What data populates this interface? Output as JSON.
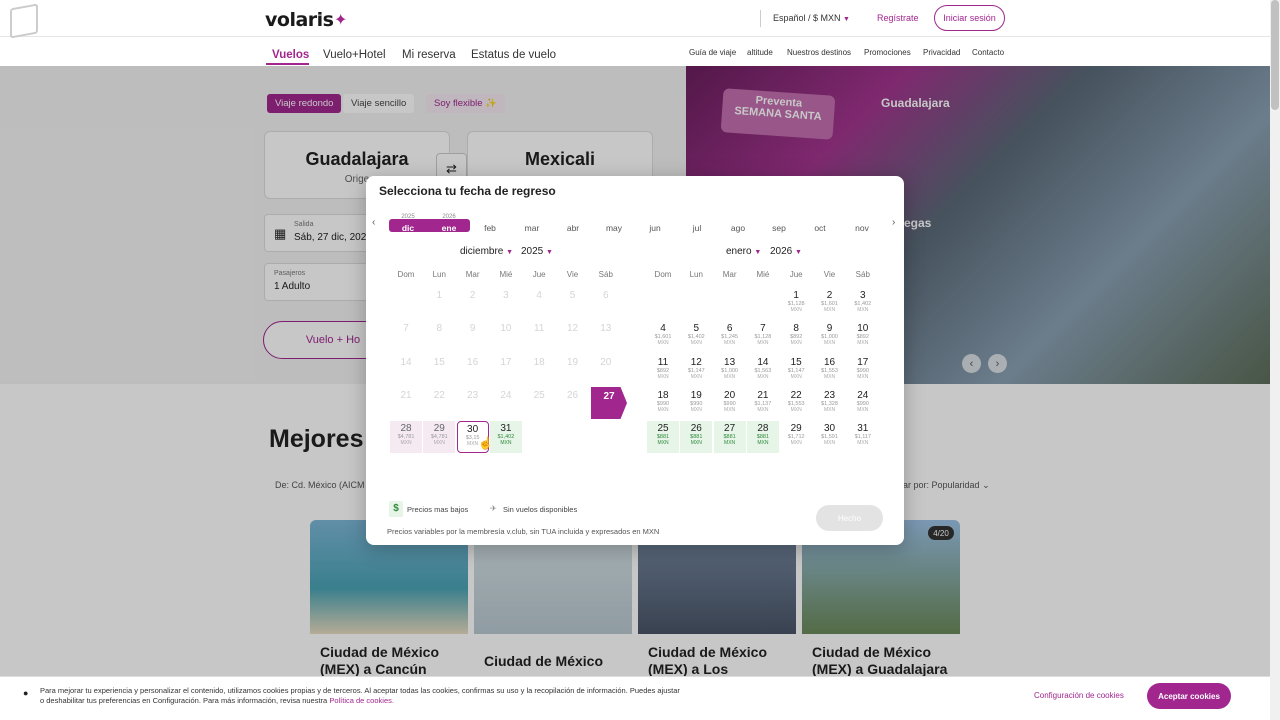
{
  "header": {
    "logo": "volaris",
    "language": "Español / $ MXN",
    "register": "Regístrate",
    "login": "Iniciar sesión"
  },
  "nav": {
    "tabs": [
      "Vuelos",
      "Vuelo+Hotel",
      "Mi reserva",
      "Estatus de vuelo"
    ],
    "links": [
      "Guía de viaje",
      "altitude",
      "Nuestros destinos",
      "Promociones",
      "Privacidad",
      "Contacto"
    ]
  },
  "hero": {
    "badge_line1": "Preventa",
    "badge_line2": "SEMANA SANTA",
    "city1": "Guadalajara",
    "city2": "egas"
  },
  "search": {
    "trip_round": "Viaje redondo",
    "trip_one": "Viaje sencillo",
    "trip_flex": "Soy flexible ✨",
    "origin": "Guadalajara",
    "origin_sub": "Orige",
    "destination": "Mexicali",
    "depart_label": "Salida",
    "depart_value": "Sáb, 27 dic, 2025",
    "pax_label": "Pasajeros",
    "pax_value": "1 Adulto",
    "search_button": "Vuelo + Ho"
  },
  "lower": {
    "title": "Mejores v",
    "filter_origin": "De: Cd. México (AICM",
    "sort": "ar por: Popularidad",
    "pager": "4/20",
    "cards": [
      "Ciudad de México (MEX) a Cancún",
      "Ciudad de México",
      "Ciudad de México (MEX) a Los Ángeles",
      "Ciudad de México (MEX) a Guadalajara"
    ]
  },
  "modal": {
    "title": "Selecciona tu fecha de regreso",
    "strip": [
      {
        "year": "2025",
        "label": "dic",
        "selected": true
      },
      {
        "year": "2026",
        "label": "ene",
        "selected": true
      },
      {
        "year": "",
        "label": "feb"
      },
      {
        "year": "",
        "label": "mar"
      },
      {
        "year": "",
        "label": "abr"
      },
      {
        "year": "",
        "label": "may"
      },
      {
        "year": "",
        "label": "jun"
      },
      {
        "year": "",
        "label": "jul"
      },
      {
        "year": "",
        "label": "ago"
      },
      {
        "year": "",
        "label": "sep"
      },
      {
        "year": "",
        "label": "oct"
      },
      {
        "year": "",
        "label": "nov"
      }
    ],
    "weekdays": [
      "Dom",
      "Lun",
      "Mar",
      "Mié",
      "Jue",
      "Vie",
      "Sáb"
    ],
    "left_month": "diciembre",
    "left_year": "2025",
    "right_month": "enero",
    "right_year": "2026",
    "currency": "MXN",
    "left_days": [
      {
        "d": "1",
        "p": ""
      },
      {
        "d": "2",
        "p": ""
      },
      {
        "d": "3",
        "p": ""
      },
      {
        "d": "4",
        "p": ""
      },
      {
        "d": "5",
        "p": ""
      },
      {
        "d": "6",
        "p": ""
      },
      {
        "d": "7",
        "p": ""
      },
      {
        "d": "8",
        "p": ""
      },
      {
        "d": "9",
        "p": ""
      },
      {
        "d": "10",
        "p": ""
      },
      {
        "d": "11",
        "p": ""
      },
      {
        "d": "12",
        "p": ""
      },
      {
        "d": "13",
        "p": ""
      },
      {
        "d": "14",
        "p": ""
      },
      {
        "d": "15",
        "p": ""
      },
      {
        "d": "16",
        "p": ""
      },
      {
        "d": "17",
        "p": ""
      },
      {
        "d": "18",
        "p": ""
      },
      {
        "d": "19",
        "p": ""
      },
      {
        "d": "20",
        "p": ""
      },
      {
        "d": "21",
        "p": ""
      },
      {
        "d": "22",
        "p": ""
      },
      {
        "d": "23",
        "p": ""
      },
      {
        "d": "24",
        "p": ""
      },
      {
        "d": "25",
        "p": ""
      },
      {
        "d": "26",
        "p": ""
      },
      {
        "d": "27",
        "p": ""
      },
      {
        "d": "28",
        "p": "$4,781"
      },
      {
        "d": "29",
        "p": "$4,781"
      },
      {
        "d": "30",
        "p": "$3,15"
      },
      {
        "d": "31",
        "p": "$1,402"
      }
    ],
    "right_days": [
      {
        "d": "1",
        "p": "$1,128"
      },
      {
        "d": "2",
        "p": "$1,601"
      },
      {
        "d": "3",
        "p": "$1,402"
      },
      {
        "d": "4",
        "p": "$1,601"
      },
      {
        "d": "5",
        "p": "$1,402"
      },
      {
        "d": "6",
        "p": "$1,245"
      },
      {
        "d": "7",
        "p": "$1,128"
      },
      {
        "d": "8",
        "p": "$892"
      },
      {
        "d": "9",
        "p": "$1,000"
      },
      {
        "d": "10",
        "p": "$892"
      },
      {
        "d": "11",
        "p": "$892"
      },
      {
        "d": "12",
        "p": "$1,147"
      },
      {
        "d": "13",
        "p": "$1,000"
      },
      {
        "d": "14",
        "p": "$1,563"
      },
      {
        "d": "15",
        "p": "$1,147"
      },
      {
        "d": "16",
        "p": "$1,553"
      },
      {
        "d": "17",
        "p": "$990"
      },
      {
        "d": "18",
        "p": "$990"
      },
      {
        "d": "19",
        "p": "$990"
      },
      {
        "d": "20",
        "p": "$990"
      },
      {
        "d": "21",
        "p": "$1,137"
      },
      {
        "d": "22",
        "p": "$1,553"
      },
      {
        "d": "23",
        "p": "$1,328"
      },
      {
        "d": "24",
        "p": "$990"
      },
      {
        "d": "25",
        "p": "$881"
      },
      {
        "d": "26",
        "p": "$881"
      },
      {
        "d": "27",
        "p": "$881"
      },
      {
        "d": "28",
        "p": "$881"
      },
      {
        "d": "29",
        "p": "$1,712"
      },
      {
        "d": "30",
        "p": "$1,591"
      },
      {
        "d": "31",
        "p": "$1,117"
      }
    ],
    "legend_low": "Precios mas bajos",
    "legend_none": "Sin vuelos disponibles",
    "note": "Precios variables por la membresía v.club, sin TUA incluida y expresados en MXN",
    "done": "Hecho"
  },
  "cookie": {
    "text": "Para mejorar tu experiencia y personalizar el contenido, utilizamos cookies propias y de terceros. Al aceptar todas las cookies, confirmas su uso y la recopilación de información. Puedes ajustar o deshabilitar tus preferencias en Configuración. Para más información, revisa nuestra ",
    "link": "Política de cookies.",
    "config": "Configuración de cookies",
    "accept": "Aceptar cookies"
  },
  "colors": {
    "brand": "#a1278f",
    "low_price": "#2f8a3a"
  }
}
